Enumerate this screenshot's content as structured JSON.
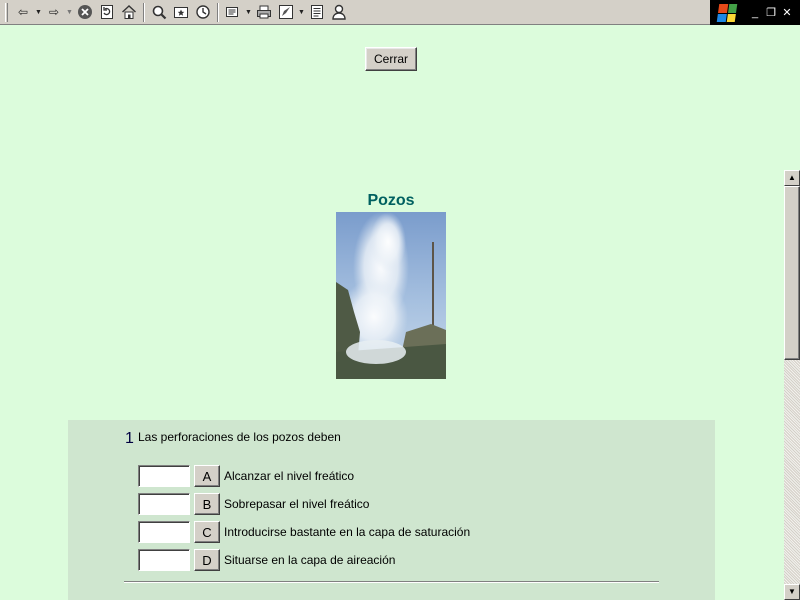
{
  "toolbar": {
    "icons": [
      "back-icon",
      "forward-icon",
      "stop-icon",
      "refresh-icon",
      "home-icon",
      "search-icon",
      "favorites-icon",
      "history-icon",
      "mail-icon",
      "print-icon",
      "edit-icon",
      "discuss-icon",
      "messenger-icon"
    ]
  },
  "window": {
    "minimize": "_",
    "restore": "❐",
    "close": "✕"
  },
  "page": {
    "close_button": "Cerrar",
    "title": "Pozos",
    "title_color": "#006060",
    "background": "#dcfcdc"
  },
  "question": {
    "number": "1",
    "text": "Las perforaciones de los pozos deben",
    "options": [
      {
        "letter": "A",
        "label": "Alcanzar el nivel freático",
        "value": ""
      },
      {
        "letter": "B",
        "label": "Sobrepasar el nivel freático",
        "value": ""
      },
      {
        "letter": "C",
        "label": "Introducirse bastante en la capa de saturación",
        "value": ""
      },
      {
        "letter": "D",
        "label": "Situarse en la capa de aireación",
        "value": ""
      }
    ]
  },
  "scrollbar": {
    "up": "▲",
    "down": "▼"
  }
}
